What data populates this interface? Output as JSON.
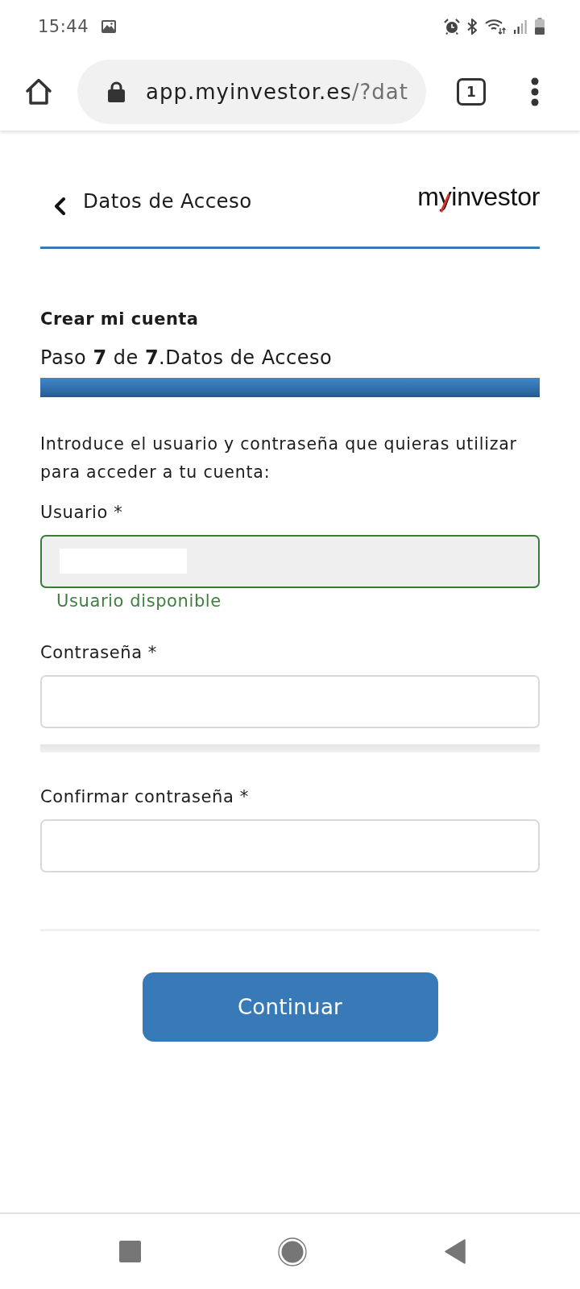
{
  "status_bar": {
    "time": "15:44"
  },
  "browser": {
    "url_host": "app.myinvestor.es",
    "url_path": "/?dat",
    "tab_count": "1"
  },
  "header": {
    "title": "Datos de Acceso",
    "logo": "myinvestor"
  },
  "form": {
    "heading": "Crear mi cuenta",
    "step": "Paso **7** de **7**.Datos de Acceso",
    "progress": {
      "level": 1
    },
    "intro": "Introduce el usuario y contraseña que quieras utilizar para acceder a tu cuenta:",
    "items": [
      {
        "kind": "field",
        "label": "Usuario *",
        "valid": true,
        "redacted": true,
        "message": "Usuario disponible"
      },
      {
        "kind": "field",
        "label": "Contraseña *",
        "valid": false,
        "redacted": false
      },
      {
        "kind": "separator"
      },
      {
        "kind": "field",
        "label": "Confirmar contraseña *",
        "valid": false,
        "redacted": false
      }
    ]
  },
  "continue_button": "Continuar"
}
